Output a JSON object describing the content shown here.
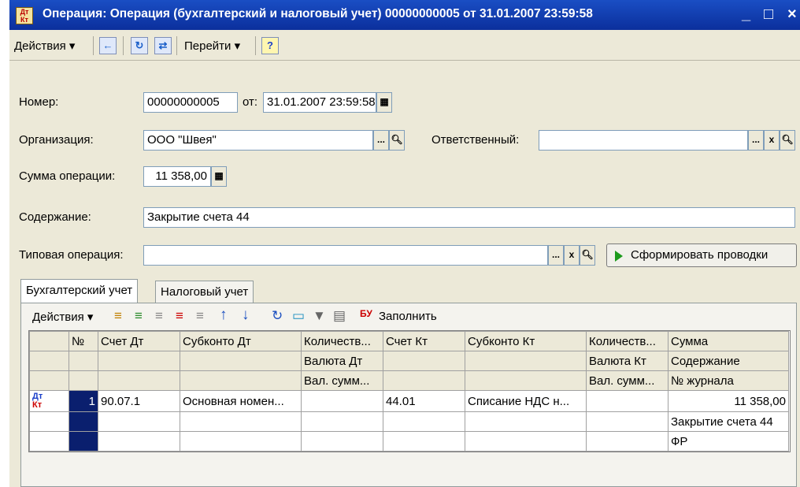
{
  "window": {
    "title": "Операция: Операция (бухгалтерский и налоговый учет) 00000000005 от 31.01.2007 23:59:58",
    "minimize": "_",
    "maximize": "□",
    "close": "×",
    "app_icon_text": "Дт Кт"
  },
  "toolbar": {
    "actions_label": "Действия ▾",
    "goto_label": "Перейти ▾",
    "help_label": "?"
  },
  "form": {
    "number_label": "Номер:",
    "number_value": "00000000005",
    "date_label": "от:",
    "date_value": "31.01.2007 23:59:58",
    "org_label": "Организация:",
    "org_value": "ООО \"Швея\"",
    "resp_label": "Ответственный:",
    "resp_value": "",
    "sum_label": "Сумма операции:",
    "sum_value": "11 358,00",
    "content_label": "Содержание:",
    "content_value": "Закрытие счета 44",
    "typical_label": "Типовая операция:",
    "typical_value": "",
    "generate_button": "Сформировать проводки",
    "ellipsis": "...",
    "clear": "x"
  },
  "tabs": [
    {
      "label": "Бухгалтерский учет"
    },
    {
      "label": "Налоговый учет"
    }
  ],
  "table_toolbar": {
    "actions_label": "Действия ▾",
    "fill_label": "Заполнить"
  },
  "table": {
    "headers_row1": [
      "№",
      "Счет Дт",
      "Субконто Дт",
      "Количеств...",
      "Счет Кт",
      "Субконто Кт",
      "Количеств...",
      "Сумма"
    ],
    "headers_row2": [
      "Валюта Дт",
      "Валюта Кт",
      "Содержание"
    ],
    "headers_row3": [
      "Вал. сумм...",
      "Вал. сумм...",
      "№ журнала"
    ],
    "row": {
      "icon_dt": "Дт",
      "icon_kt": "Кт",
      "num": "1",
      "acc_dt": "90.07.1",
      "sub_dt": "Основная номен...",
      "acc_kt": "44.01",
      "sub_kt": "Списание НДС н...",
      "sum": "11 358,00",
      "content": "Закрытие счета 44",
      "journal": "ФР"
    }
  }
}
